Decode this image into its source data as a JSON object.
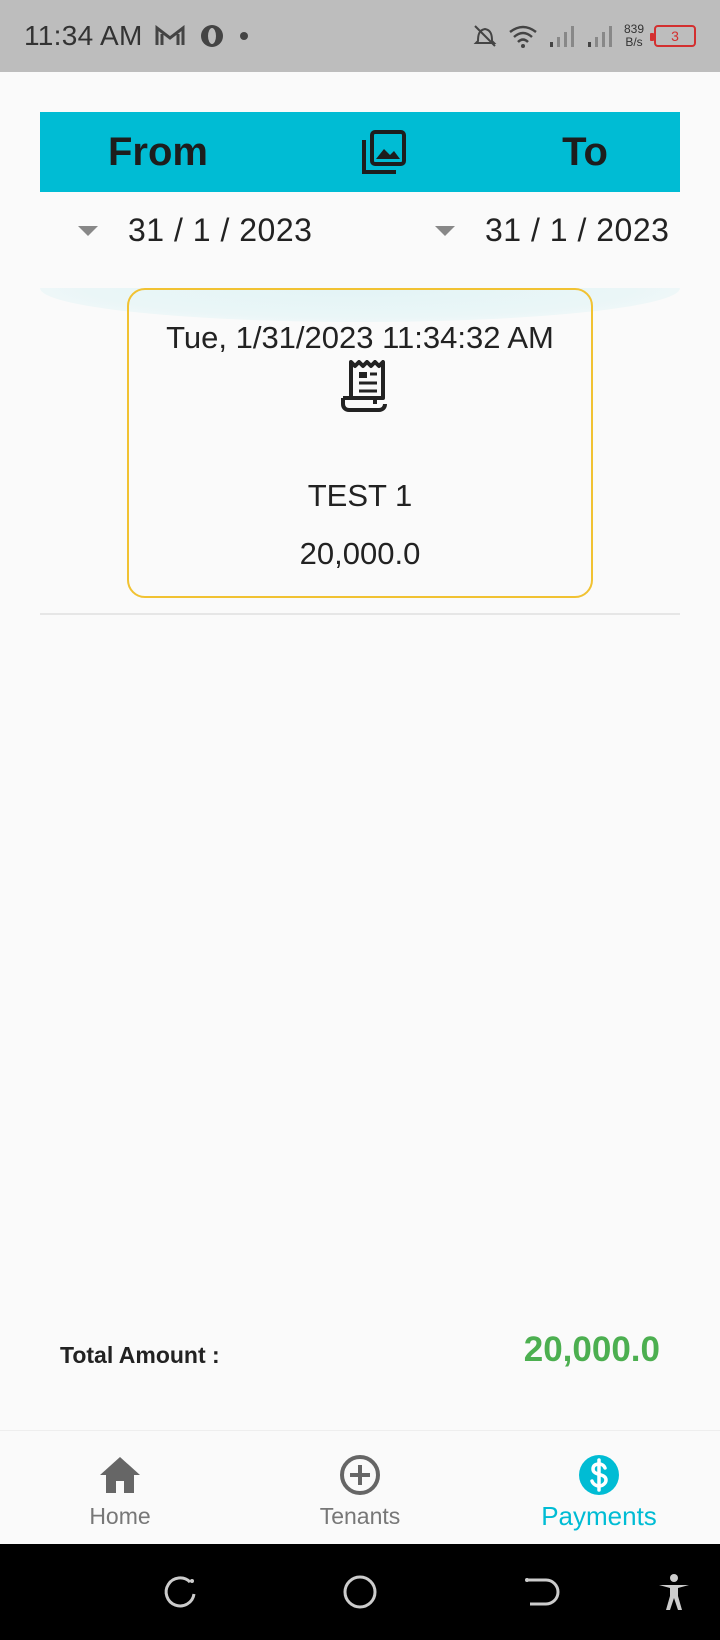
{
  "status_bar": {
    "time": "11:34 AM",
    "net_speed_value": "839",
    "net_speed_unit": "B/s",
    "battery_level": "3"
  },
  "header": {
    "from_label": "From",
    "to_label": "To"
  },
  "date_filter": {
    "from_date": "31 / 1 / 2023",
    "to_date": "31 / 1 / 2023"
  },
  "payments": [
    {
      "datetime": "Tue, 1/31/2023 11:34:32 AM",
      "tenant": "TEST 1",
      "amount": "20,000.0",
      "icon": "receipt-icon"
    }
  ],
  "summary": {
    "total_label": "Total Amount :",
    "total_value": "20,000.0"
  },
  "bottom_nav": {
    "items": [
      {
        "label": "Home",
        "icon": "home-icon"
      },
      {
        "label": "Tenants",
        "icon": "add-circle-icon"
      },
      {
        "label": "Payments",
        "icon": "dollar-circle-icon",
        "active": true
      }
    ]
  },
  "colors": {
    "accent": "#00bcd4",
    "card_border": "#f1c232",
    "total_green": "#4caf50",
    "battery_red": "#d32f2f"
  }
}
